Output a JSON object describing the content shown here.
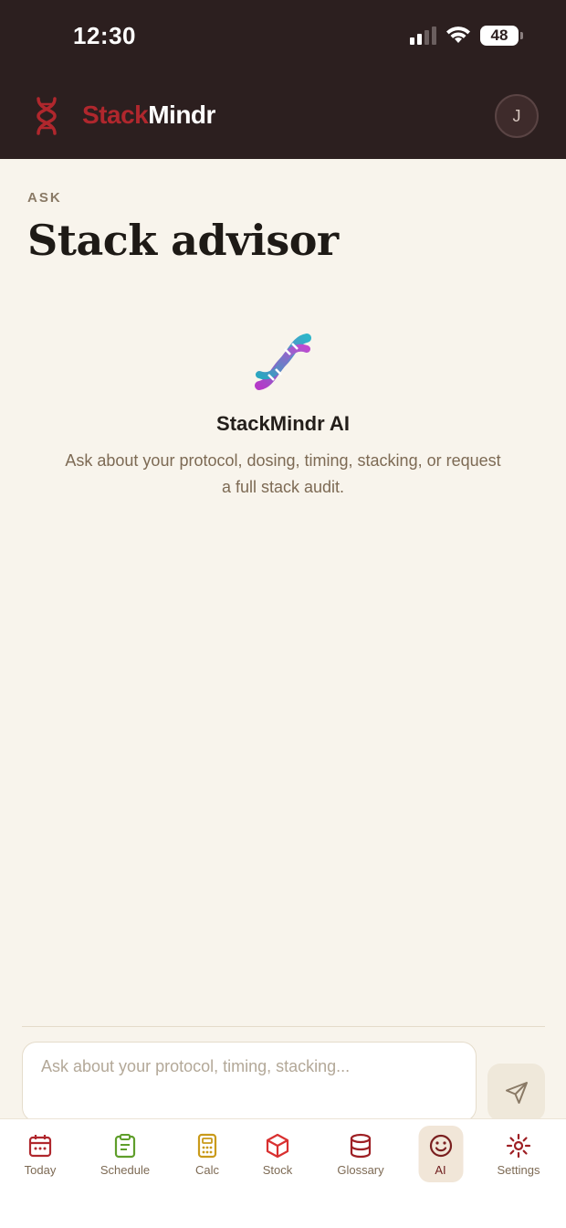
{
  "status_bar": {
    "time": "12:30",
    "battery": "48"
  },
  "header": {
    "brand_part1": "Stack",
    "brand_part2": "Mindr",
    "avatar_initial": "J",
    "colors": {
      "brand_red": "#b0272d",
      "header_bg": "#2c1f1f"
    }
  },
  "page": {
    "eyebrow": "ASK",
    "title": "Stack advisor"
  },
  "empty_state": {
    "icon": "dna-icon",
    "name": "StackMindr AI",
    "description": "Ask about your protocol, dosing, timing, stacking, or request a full stack audit."
  },
  "composer": {
    "placeholder": "Ask about your protocol, timing, stacking...",
    "value": "",
    "send_icon": "send-icon"
  },
  "tabs": [
    {
      "label": "Today",
      "icon": "calendar-icon",
      "color": "#b0272d"
    },
    {
      "label": "Schedule",
      "icon": "clipboard-icon",
      "color": "#5f9e2b"
    },
    {
      "label": "Calc",
      "icon": "calculator-icon",
      "color": "#c99a1a"
    },
    {
      "label": "Stock",
      "icon": "box-icon",
      "color": "#d93030"
    },
    {
      "label": "Glossary",
      "icon": "database-icon",
      "color": "#9e1f24"
    },
    {
      "label": "AI",
      "icon": "smiley-icon",
      "color": "#7a1f1f",
      "active": true
    },
    {
      "label": "Settings",
      "icon": "gear-icon",
      "color": "#9e1f24"
    }
  ]
}
